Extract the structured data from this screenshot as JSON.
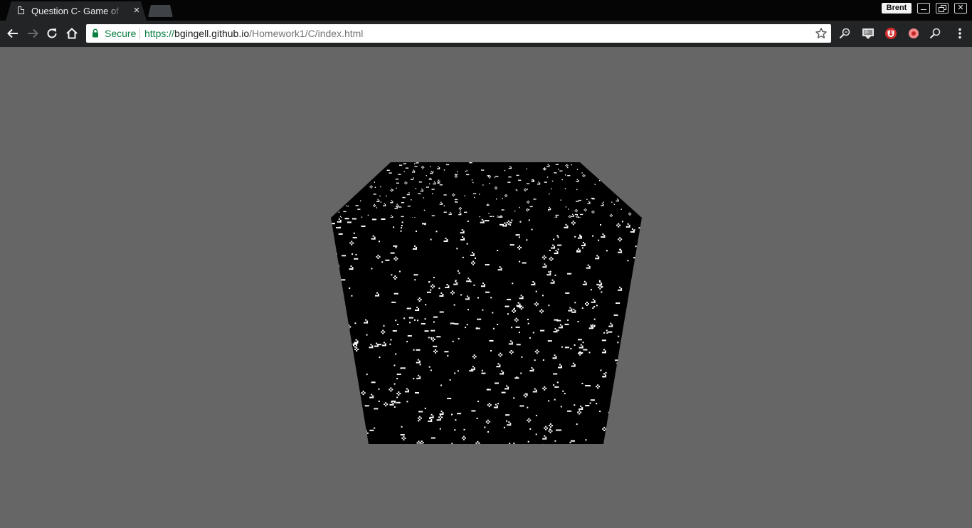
{
  "tab": {
    "title": "Question C- Game of Life",
    "close_symbol": "×"
  },
  "profile": {
    "name": "Brent"
  },
  "window_controls": {
    "close_symbol": "✕"
  },
  "address_bar": {
    "secure_label": "Secure",
    "url_scheme": "https://",
    "url_host": "bgingell.github.io",
    "url_path": "/Homework1/C/index.html"
  },
  "icons": {
    "tab": "document-icon",
    "back": "back-arrow-icon",
    "forward": "forward-arrow-icon",
    "reload": "reload-icon",
    "home": "home-icon",
    "lock": "lock-icon",
    "bookmark": "star-icon",
    "extensions": [
      "magnifier-extension-icon",
      "screenshot-extension-icon",
      "ublock-origin-icon",
      "record-extension-icon",
      "zoom-extension-icon"
    ],
    "menu": "three-dot-menu-icon"
  },
  "colors": {
    "page_background": "#666666",
    "cube_face": "#000000",
    "live_cell": "#ffffff",
    "secure_green": "#0b8043"
  }
}
